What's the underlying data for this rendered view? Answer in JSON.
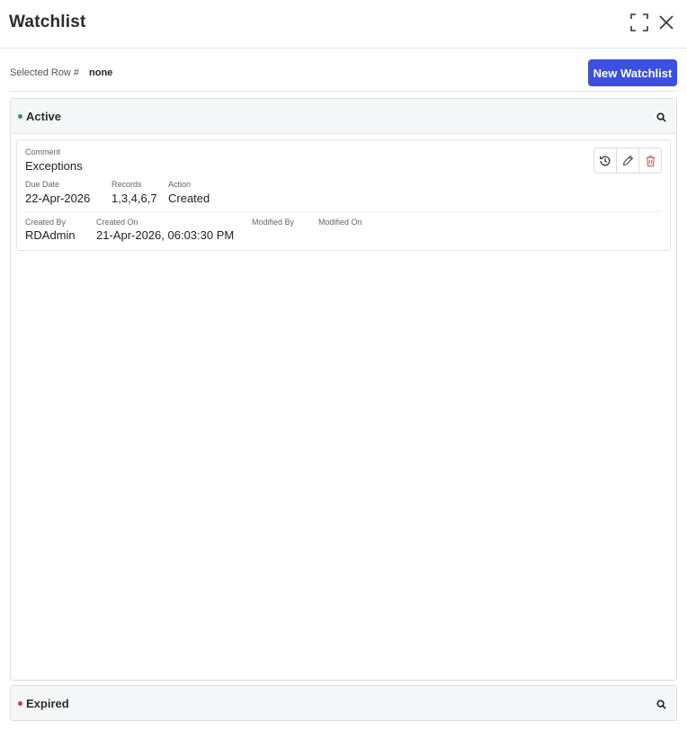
{
  "header": {
    "title": "Watchlist",
    "expand_icon": "expand-icon",
    "close_icon": "close-icon"
  },
  "toolbar": {
    "selected_row_label": "Selected Row #",
    "selected_row_value": "none",
    "new_watchlist_label": "New Watchlist"
  },
  "sections": {
    "active": {
      "title": "Active",
      "status_color": "#2a9a4a",
      "card": {
        "comment_label": "Comment",
        "comment_value": "Exceptions",
        "due_date_label": "Due Date",
        "due_date_value": "22-Apr-2026",
        "records_label": "Records",
        "records_value": "1,3,4,6,7",
        "action_label": "Action",
        "action_value": "Created",
        "created_by_label": "Created By",
        "created_by_value": "RDAdmin",
        "created_on_label": "Created On",
        "created_on_value": "21-Apr-2026, 06:03:30 PM",
        "modified_by_label": "Modified By",
        "modified_by_value": "",
        "modified_on_label": "Modified On",
        "modified_on_value": "",
        "actions": [
          "history-icon",
          "edit-icon",
          "delete-icon"
        ]
      }
    },
    "expired": {
      "title": "Expired",
      "status_color": "#d43a3a"
    }
  },
  "colors": {
    "primary_button": "#3b4fe0",
    "delete_icon": "#d9534f"
  }
}
